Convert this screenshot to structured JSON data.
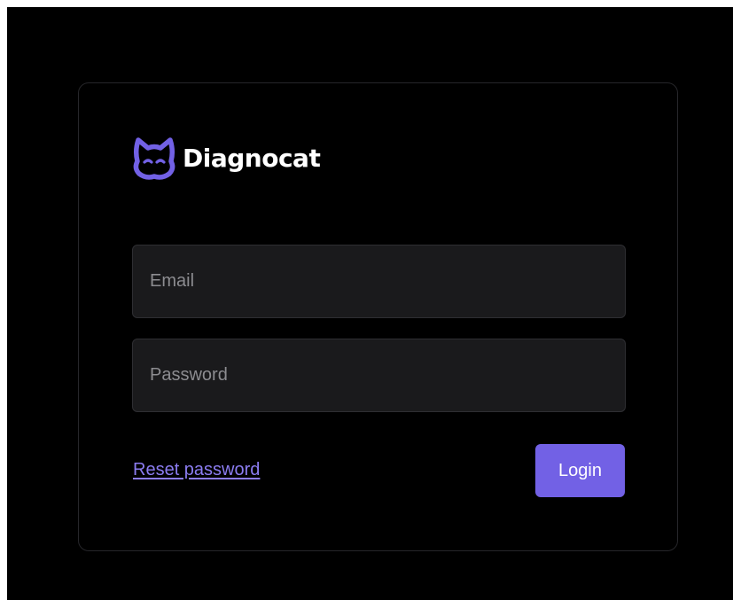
{
  "brand": {
    "name": "Diagnocat",
    "icon": "diagnocat-cat-logo-icon",
    "color": "#7261e5"
  },
  "form": {
    "email_placeholder": "Email",
    "password_placeholder": "Password",
    "reset_label": "Reset password",
    "login_label": "Login"
  },
  "colors": {
    "background": "#000000",
    "field_background": "#1a1a1c",
    "accent": "#7261e5",
    "link": "#8b7cf0"
  }
}
